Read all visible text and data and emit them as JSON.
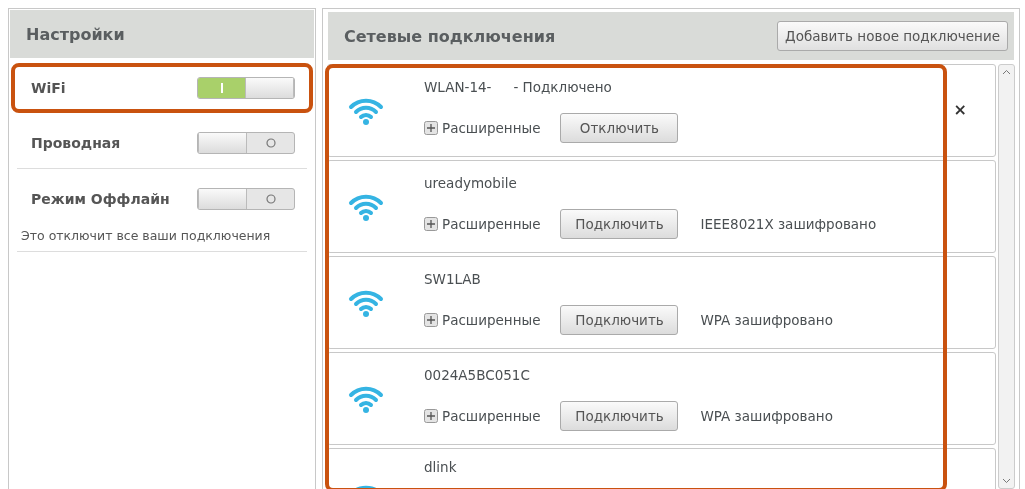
{
  "settings": {
    "title": "Настройки",
    "toggles": [
      {
        "label": "WiFi",
        "on": true,
        "highlighted": true
      },
      {
        "label": "Проводная",
        "on": false,
        "highlighted": false
      },
      {
        "label": "Режим Оффлайн",
        "on": false,
        "highlighted": false,
        "note": "Это отключит все ваши подключения"
      }
    ]
  },
  "connections": {
    "title": "Сетевые подключения",
    "add_button": "Добавить новое подключение",
    "highlighted": true,
    "networks": [
      {
        "name": "WLAN-14-",
        "status": "- Подключено",
        "advanced": "Расширенные",
        "action": "Отключить",
        "close": "×"
      },
      {
        "name": "ureadymobile",
        "advanced": "Расширенные",
        "action": "Подключить",
        "security": "IEEE8021X зашифровано"
      },
      {
        "name": "SW1LAB",
        "advanced": "Расширенные",
        "action": "Подключить",
        "security": "WPA зашифровано"
      },
      {
        "name": "0024A5BC051C",
        "advanced": "Расширенные",
        "action": "Подключить",
        "security": "WPA зашифровано"
      },
      {
        "name": "dlink"
      }
    ]
  }
}
